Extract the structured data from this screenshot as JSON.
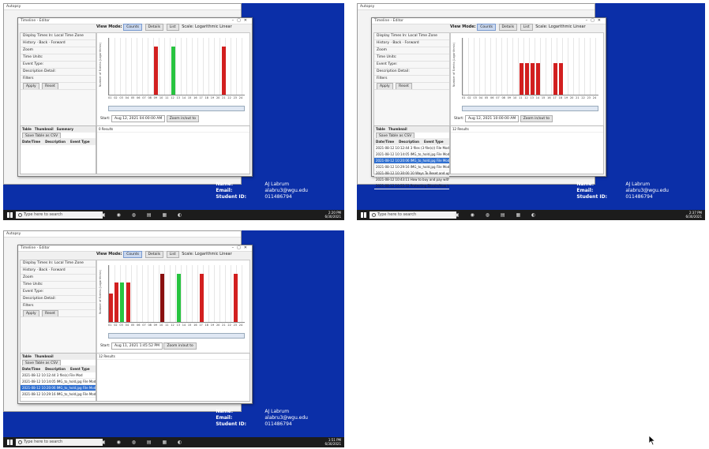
{
  "student": {
    "name_label": "Name:",
    "name": "AJ Labrum",
    "email_label": "Email:",
    "email": "alabru3@wgu.edu",
    "id_label": "Student ID:",
    "id": "011486794"
  },
  "app_title": "Autopsy",
  "editor_title": "Timeline - Editor",
  "timeline_tab": "Timeline",
  "view_mode_label": "View Mode:",
  "view_buttons": [
    "Counts",
    "Details",
    "List"
  ],
  "scale_label": "Scale:",
  "scale_options": [
    "Logarithmic",
    "Linear"
  ],
  "time_zone_label": "Display Times In:",
  "time_zone_options": [
    "Local Time Zone",
    "GMT / UTC"
  ],
  "nav": {
    "history": "History",
    "back": "Back",
    "forward": "Forward"
  },
  "left_rows": [
    "Zoom",
    "Time Units:",
    "Event Type:",
    "Description Detail:",
    "Filters"
  ],
  "apply_label": "Apply",
  "reset_label": "Reset",
  "start_label": "Start:",
  "zoom_label": "Zoom in/out to",
  "ylabel": "Number of Events (Logarithmic)",
  "tick_labels": [
    "01",
    "02",
    "03",
    "04",
    "05",
    "06",
    "07",
    "08",
    "09",
    "10",
    "11",
    "12",
    "13",
    "14",
    "15",
    "16",
    "17",
    "18",
    "19",
    "20",
    "21",
    "22",
    "23",
    "24"
  ],
  "shots": [
    {
      "start": "Aug 12, 2021 04:00:00 AM",
      "bars": [
        {
          "x": 9,
          "v": 0.85,
          "c": "#d21f1f"
        },
        {
          "x": 12,
          "v": 0.85,
          "c": "#28c440"
        },
        {
          "x": 21,
          "v": 0.85,
          "c": "#d21f1f"
        }
      ],
      "table_header": [
        "Date/Time",
        "Description",
        "Event Type"
      ],
      "rows": [],
      "tabs": [
        "Table",
        "Thumbnail",
        "Summary"
      ],
      "save_label": "Save Table as CSV",
      "results": "0 Results",
      "clock_time": "2:20 PM",
      "clock_date": "6/30/2021"
    },
    {
      "start": "Aug 12, 2021 10:00:00 AM",
      "bars": [
        {
          "x": 11,
          "v": 0.55,
          "c": "#d21f1f"
        },
        {
          "x": 12,
          "v": 0.55,
          "c": "#d21f1f"
        },
        {
          "x": 13,
          "v": 0.55,
          "c": "#d21f1f"
        },
        {
          "x": 14,
          "v": 0.55,
          "c": "#d21f1f"
        },
        {
          "x": 17,
          "v": 0.55,
          "c": "#d21f1f"
        },
        {
          "x": 18,
          "v": 0.55,
          "c": "#d21f1f"
        }
      ],
      "table_header": [
        "Date/Time",
        "Description",
        "Event Type"
      ],
      "rows": [
        [
          "2021-08-12 10:12:44",
          "3 files (3 file(s))",
          "File Mod"
        ],
        [
          "2021-08-12 10:14:05",
          "IMG_to_hold.jpg",
          "File Mod"
        ],
        [
          "2021-08-12 10:20:06",
          "IMG_to_hold.jpg",
          "File Mod"
        ],
        [
          "2021-08-12 10:29:16",
          "IMG_to_hold.jpg",
          "File Mod"
        ],
        [
          "2021-08-12 10:30:00",
          "10 Ways To Reset and update.docx",
          "File Mod"
        ],
        [
          "2021-08-12 10:43:11",
          "How to buy and pay with bitcoin",
          "File Mod"
        ],
        [
          "2021-08-12 10:55:32",
          "Protecting Bitcoin/How to Hid",
          "File Mod"
        ]
      ],
      "tabs": [
        "Table",
        "Thumbnail"
      ],
      "save_label": "Save Table as CSV",
      "results": "12 Results",
      "clock_time": "2:37 PM",
      "clock_date": "6/30/2021"
    },
    {
      "start": "Aug 11, 2021 1:45:52 PM",
      "bars": [
        {
          "x": 1,
          "v": 0.5,
          "c": "#d21f1f"
        },
        {
          "x": 2,
          "v": 0.7,
          "c": "#d21f1f"
        },
        {
          "x": 3,
          "v": 0.7,
          "c": "#28c440"
        },
        {
          "x": 4,
          "v": 0.7,
          "c": "#d21f1f"
        },
        {
          "x": 10,
          "v": 0.85,
          "c": "#8a1010"
        },
        {
          "x": 13,
          "v": 0.85,
          "c": "#28c440"
        },
        {
          "x": 17,
          "v": 0.85,
          "c": "#d21f1f"
        },
        {
          "x": 23,
          "v": 0.85,
          "c": "#d21f1f"
        }
      ],
      "table_header": [
        "Date/Time",
        "Description",
        "Event Type"
      ],
      "rows": [
        [
          "2021-08-12 10:12:44",
          "3 file(s)",
          "File Mod"
        ],
        [
          "2021-08-12 10:14:05",
          "IMG_to_hold.jpg",
          "File Mod"
        ],
        [
          "2021-08-12 10:20:06",
          "IMG_to_hold.jpg",
          "File Mod"
        ],
        [
          "2021-08-12 10:29:16",
          "IMG_to_hold.jpg",
          "File Mod"
        ]
      ],
      "tabs": [
        "Table",
        "Thumbnail"
      ],
      "save_label": "Save Table as CSV",
      "results": "12 Results",
      "clock_time": "1:51 PM",
      "clock_date": "6/30/2021"
    }
  ],
  "taskbar": {
    "search_placeholder": "Type here to search"
  }
}
